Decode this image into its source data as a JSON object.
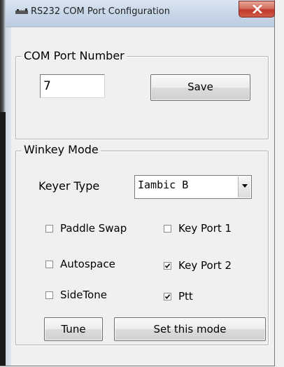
{
  "window": {
    "title": "RS232 COM Port Configuration",
    "close_glyph": "×"
  },
  "com_port": {
    "group_label": "COM Port Number",
    "value": "7",
    "save_label": "Save"
  },
  "winkey": {
    "group_label": "Winkey Mode",
    "keyer_type_label": "Keyer Type",
    "keyer_type_value": "Iambic B",
    "checkboxes": [
      {
        "label": "Paddle Swap",
        "checked": false
      },
      {
        "label": "Key Port 1",
        "checked": false
      },
      {
        "label": "Autospace",
        "checked": false
      },
      {
        "label": "Key Port 2",
        "checked": true
      },
      {
        "label": "SideTone",
        "checked": false
      },
      {
        "label": "Ptt",
        "checked": true
      }
    ],
    "tune_label": "Tune",
    "set_mode_label": "Set this mode"
  },
  "colors": {
    "close_button": "#c0392b",
    "titlebar": "#c8d7e8",
    "dialog_bg": "#f0f0f0"
  },
  "icons": {
    "window": "app-icon",
    "close": "close-icon",
    "dropdown": "chevron-down-icon",
    "check": "checkmark-icon"
  }
}
